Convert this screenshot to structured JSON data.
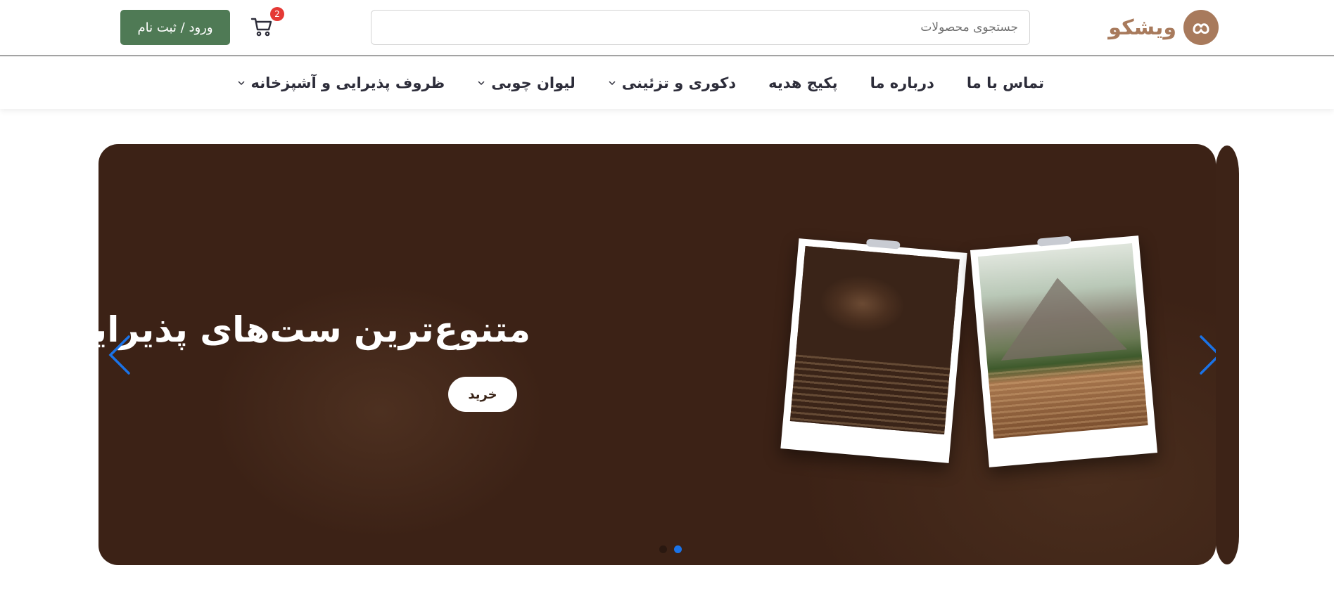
{
  "header": {
    "logo_text": "ویشکو",
    "search_placeholder": "جستجوی محصولات",
    "cart_count": "2",
    "login_label": "ورود / ثبت نام"
  },
  "nav": {
    "items": [
      {
        "label": "ظروف پذیرایی و آشپزخانه",
        "dropdown": true
      },
      {
        "label": "لیوان چوبی",
        "dropdown": true
      },
      {
        "label": "دکوری و تزئینی",
        "dropdown": true
      },
      {
        "label": "پکیج هدیه",
        "dropdown": false
      },
      {
        "label": "درباره ما",
        "dropdown": false
      },
      {
        "label": "تماس با ما",
        "dropdown": false
      }
    ]
  },
  "hero": {
    "title": "متنوع‌ترین ست‌های پذیرایی",
    "buy_label": "خرید",
    "slide_count": 2,
    "active_slide": 2
  },
  "colors": {
    "brand": "#a87a5c",
    "login_button": "#4f7a55",
    "hero_background": "#3c2216",
    "accent": "#1a73e8",
    "badge": "#e53935"
  }
}
